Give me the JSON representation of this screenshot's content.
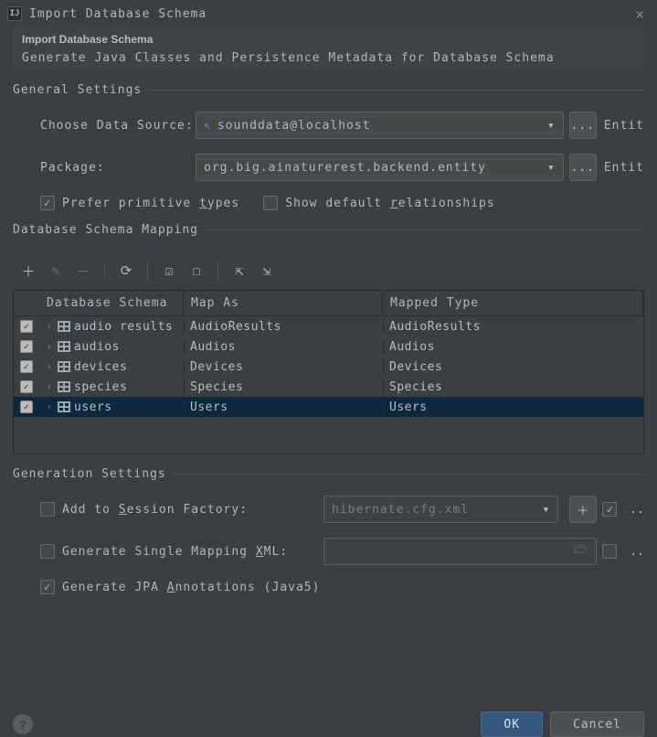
{
  "window": {
    "title": "Import Database Schema"
  },
  "header": {
    "title": "Import Database Schema",
    "subtitle": "Generate Java Classes and Persistence Metadata for Database Schema"
  },
  "general": {
    "section_title": "General Settings",
    "datasource_label": "Choose Data Source:",
    "datasource_value": "sounddata@localhost",
    "datasource_side": "Entit",
    "package_label": "Package:",
    "package_value": "org.big.ainaturerest.backend.entity",
    "package_side": "Entit",
    "prefer_primitive_label": "Prefer primitive types",
    "prefer_primitive_checked": true,
    "show_default_rel_label": "Show default relationships",
    "show_default_rel_checked": false,
    "browse_label": "..."
  },
  "mapping": {
    "section_title": "Database Schema Mapping",
    "columns": {
      "c1": "Database Schema",
      "c2": "Map As",
      "c3": "Mapped Type"
    },
    "rows": [
      {
        "checked": true,
        "name": "audio results",
        "map_as": "AudioResults",
        "mapped_type": "AudioResults",
        "selected": false
      },
      {
        "checked": true,
        "name": "audios",
        "map_as": "Audios",
        "mapped_type": "Audios",
        "selected": false
      },
      {
        "checked": true,
        "name": "devices",
        "map_as": "Devices",
        "mapped_type": "Devices",
        "selected": false
      },
      {
        "checked": true,
        "name": "species",
        "map_as": "Species",
        "mapped_type": "Species",
        "selected": false
      },
      {
        "checked": true,
        "name": "users",
        "map_as": "Users",
        "mapped_type": "Users",
        "selected": true
      }
    ]
  },
  "generation": {
    "section_title": "Generation Settings",
    "session_factory_label": "Add to Session Factory:",
    "session_factory_checked": false,
    "session_factory_value": "hibernate.cfg.xml",
    "session_side_checked": true,
    "session_side_text": "..",
    "single_mapping_label": "Generate Single Mapping XML:",
    "single_mapping_checked": false,
    "single_side_checked": false,
    "single_side_text": "..",
    "jpa_label": "Generate JPA Annotations (Java5)",
    "jpa_checked": true
  },
  "footer": {
    "ok": "OK",
    "cancel": "Cancel"
  }
}
